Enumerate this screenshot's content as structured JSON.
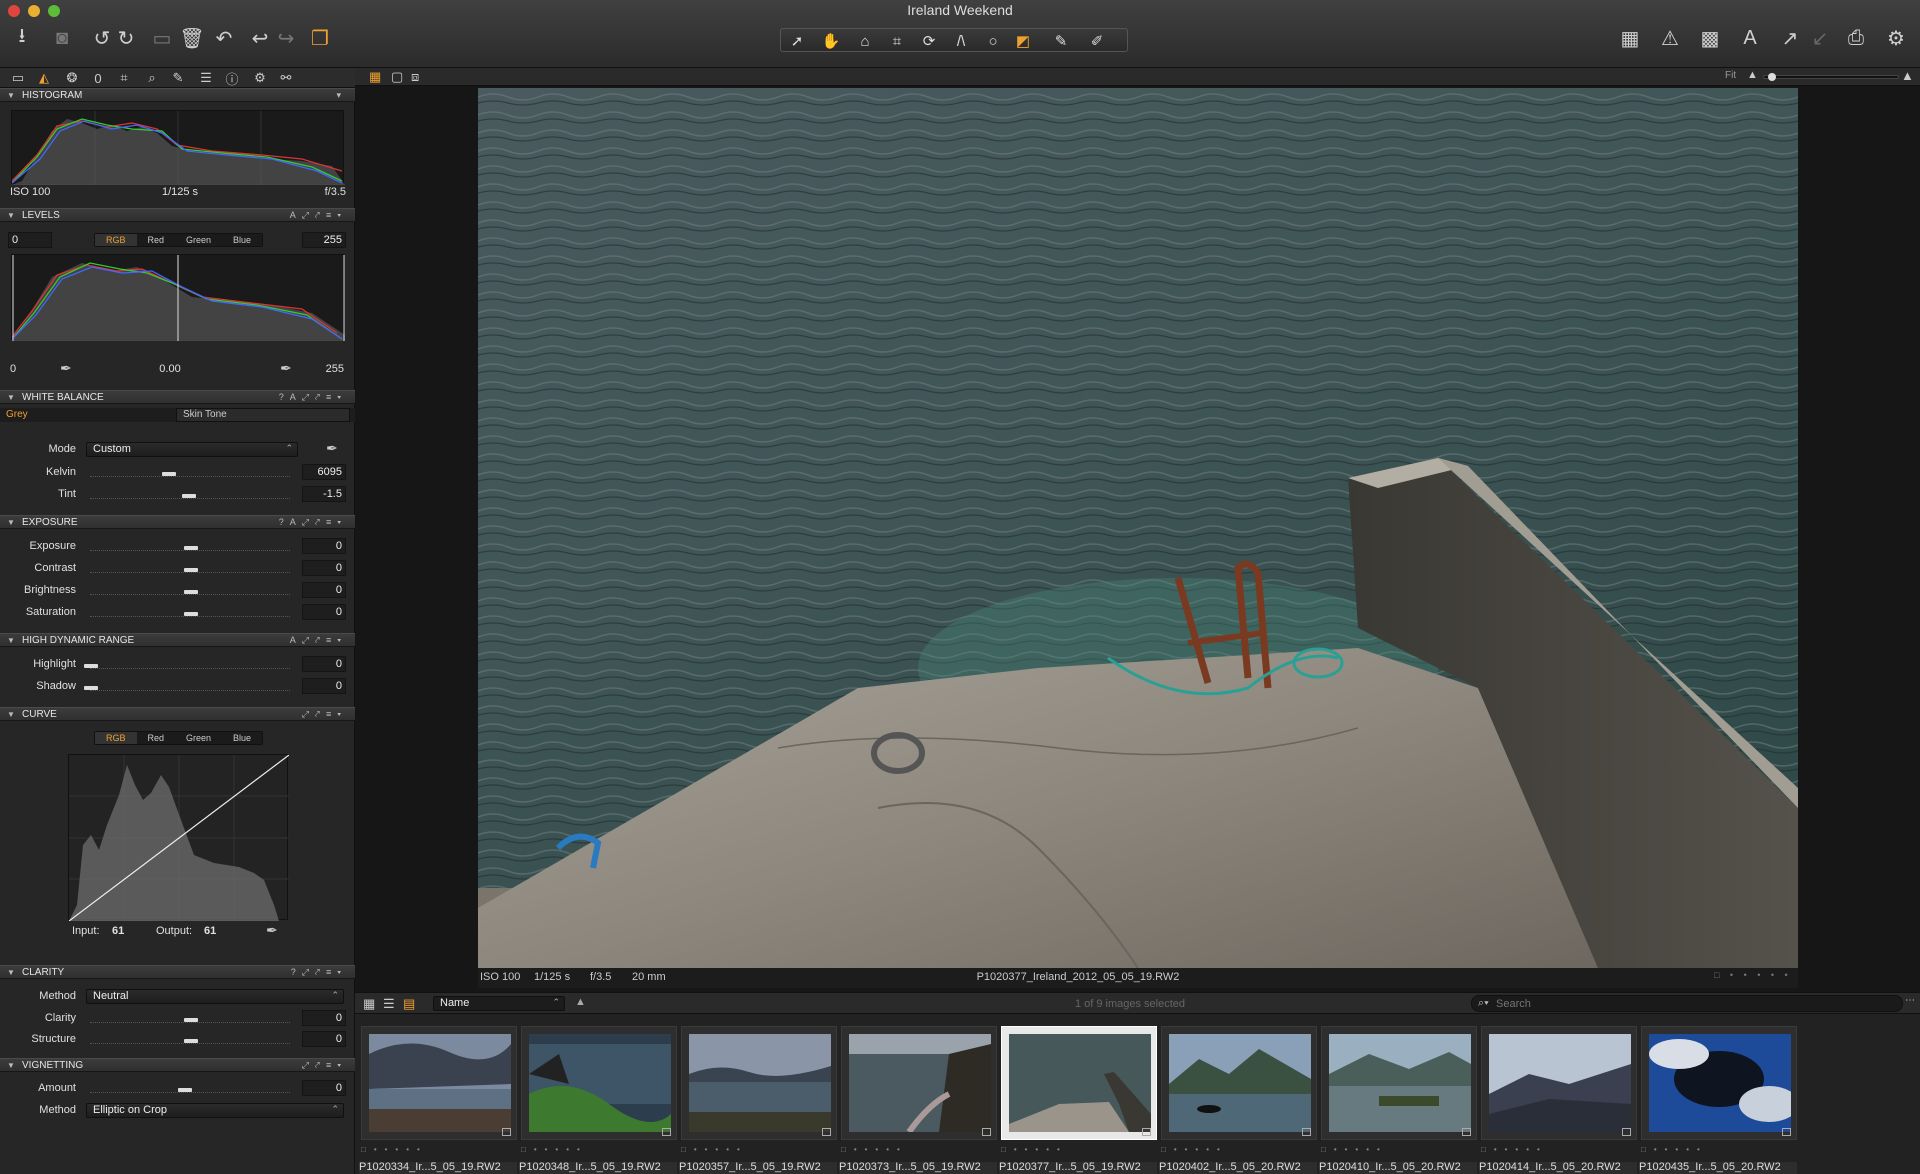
{
  "window": {
    "title": "Ireland Weekend"
  },
  "histogram": {
    "title": "HISTOGRAM",
    "iso": "ISO 100",
    "shutter": "1/125 s",
    "aperture": "f/3.5"
  },
  "levels": {
    "title": "LEVELS",
    "left_value": "0",
    "right_value": "255",
    "channels": [
      "RGB",
      "Red",
      "Green",
      "Blue"
    ],
    "active_channel": "RGB",
    "out_left": "0",
    "midpoint": "0.00",
    "out_right": "255"
  },
  "white_balance": {
    "title": "WHITE BALANCE",
    "tabs": [
      "Grey",
      "Skin Tone"
    ],
    "mode_label": "Mode",
    "mode_value": "Custom",
    "kelvin_label": "Kelvin",
    "kelvin_value": "6095",
    "tint_label": "Tint",
    "tint_value": "-1.5"
  },
  "exposure": {
    "title": "EXPOSURE",
    "rows": [
      {
        "label": "Exposure",
        "value": "0"
      },
      {
        "label": "Contrast",
        "value": "0"
      },
      {
        "label": "Brightness",
        "value": "0"
      },
      {
        "label": "Saturation",
        "value": "0"
      }
    ]
  },
  "hdr": {
    "title": "HIGH DYNAMIC RANGE",
    "rows": [
      {
        "label": "Highlight",
        "value": "0"
      },
      {
        "label": "Shadow",
        "value": "0"
      }
    ]
  },
  "curve": {
    "title": "CURVE",
    "channels": [
      "RGB",
      "Red",
      "Green",
      "Blue"
    ],
    "input_label": "Input:",
    "input_value": "61",
    "output_label": "Output:",
    "output_value": "61"
  },
  "clarity": {
    "title": "CLARITY",
    "method_label": "Method",
    "method_value": "Neutral",
    "rows": [
      {
        "label": "Clarity",
        "value": "0"
      },
      {
        "label": "Structure",
        "value": "0"
      }
    ]
  },
  "vignetting": {
    "title": "VIGNETTING",
    "amount_label": "Amount",
    "amount_value": "0",
    "method_label": "Method",
    "method_value": "Elliptic on Crop"
  },
  "viewer": {
    "fit_label": "Fit",
    "iso": "ISO 100",
    "shutter": "1/125 s",
    "aperture": "f/3.5",
    "focal": "20 mm",
    "filename": "P1020377_Ireland_2012_05_05_19.RW2"
  },
  "browser": {
    "sort_value": "Name",
    "selection_status": "1 of 9 images selected",
    "search_placeholder": "Search",
    "thumbnails": [
      {
        "name": "P1020334_Ir...5_05_19.RW2"
      },
      {
        "name": "P1020348_Ir...5_05_19.RW2"
      },
      {
        "name": "P1020357_Ir...5_05_19.RW2"
      },
      {
        "name": "P1020373_Ir...5_05_19.RW2"
      },
      {
        "name": "P1020377_Ir...5_05_19.RW2"
      },
      {
        "name": "P1020402_Ir...5_05_20.RW2"
      },
      {
        "name": "P1020410_Ir...5_05_20.RW2"
      },
      {
        "name": "P1020414_Ir...5_05_20.RW2"
      },
      {
        "name": "P1020435_Ir...5_05_20.RW2"
      }
    ]
  },
  "colors": {
    "accent": "#f0a030",
    "panel": "#262626",
    "background": "#161616"
  }
}
